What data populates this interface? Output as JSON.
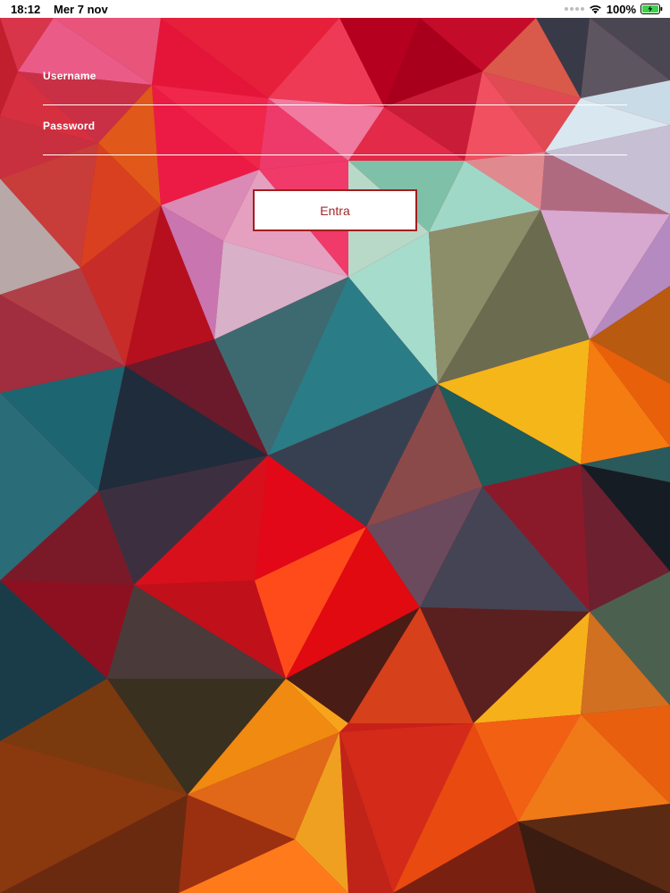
{
  "status_bar": {
    "time": "18:12",
    "date": "Mer 7 nov",
    "battery_percent": "100%",
    "battery_level": 1.0
  },
  "login": {
    "username_label": "Username",
    "username_value": "",
    "password_label": "Password",
    "password_value": "",
    "submit_label": "Entra"
  },
  "colors": {
    "button_border": "#a21e1e",
    "button_text": "#a02828",
    "battery_green": "#3bd14a"
  }
}
